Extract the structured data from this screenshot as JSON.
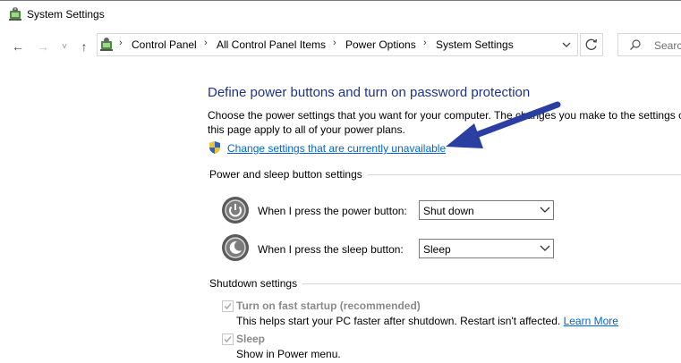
{
  "window": {
    "title": "System Settings",
    "icon": "power-options-icon"
  },
  "nav": {
    "back": "←",
    "forward": "→",
    "recent": "˅",
    "up": "↑",
    "breadcrumbs": [
      "Control Panel",
      "All Control Panel Items",
      "Power Options",
      "System Settings"
    ],
    "search_placeholder": "Search"
  },
  "main": {
    "heading": "Define power buttons and turn on password protection",
    "description": "Choose the power settings that you want for your computer. The changes you make to the settings on this page apply to all of your power plans.",
    "change_link": "Change settings that are currently unavailable",
    "power_section": {
      "title": "Power and sleep button settings",
      "rows": [
        {
          "label": "When I press the power button:",
          "value": "Shut down",
          "icon": "power-button-icon"
        },
        {
          "label": "When I press the sleep button:",
          "value": "Sleep",
          "icon": "sleep-button-icon"
        }
      ]
    },
    "shutdown_section": {
      "title": "Shutdown settings",
      "options": [
        {
          "label": "Turn on fast startup (recommended)",
          "description": "This helps start your PC faster after shutdown. Restart isn't affected.",
          "link": "Learn More",
          "checked": true
        },
        {
          "label": "Sleep",
          "description": "Show in Power menu.",
          "checked": true
        }
      ]
    }
  },
  "colors": {
    "heading": "#1e3287",
    "link": "#0066cc",
    "arrow": "#2b3fa3"
  }
}
